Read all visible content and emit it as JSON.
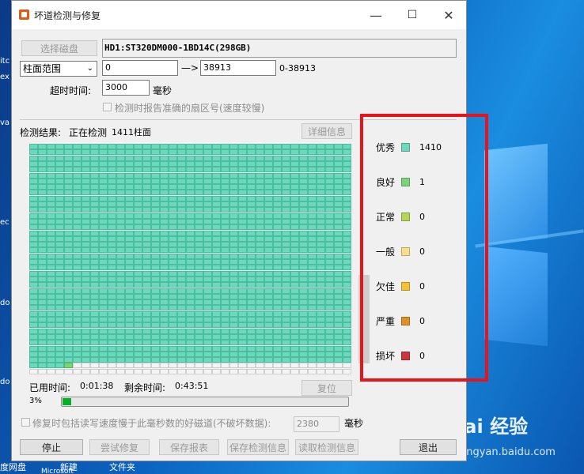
{
  "window": {
    "title": "坏道检测与修复",
    "minimize_icon": "—",
    "maximize_icon": "☐",
    "close_icon": "✕"
  },
  "disk": {
    "select_button": "选择磁盘",
    "name": "HD1:ST320DM000-1BD14C(298GB)"
  },
  "range": {
    "mode": "柱面范围",
    "from": "0",
    "arrow": "—>",
    "to": "38913",
    "hint": "0-38913"
  },
  "timeout": {
    "label": "超时时间:",
    "value": "3000",
    "unit": "毫秒"
  },
  "report_checkbox_label": "检测时报告准确的扇区号(速度较慢)",
  "result": {
    "label": "检测结果:",
    "status": "正在检测",
    "detail": "1411柱面",
    "detail_button": "详细信息"
  },
  "legend": [
    {
      "name": "优秀",
      "color": "#6fd8bc",
      "count": "1410"
    },
    {
      "name": "良好",
      "color": "#7dd37a",
      "count": "1"
    },
    {
      "name": "正常",
      "color": "#b5d45a",
      "count": "0"
    },
    {
      "name": "一般",
      "color": "#f7e08a",
      "count": "0"
    },
    {
      "name": "欠佳",
      "color": "#f5c233",
      "count": "0"
    },
    {
      "name": "严重",
      "color": "#e0902a",
      "count": "0"
    },
    {
      "name": "损坏",
      "color": "#c9373c",
      "count": "0"
    }
  ],
  "grid": {
    "total_cells": 1480,
    "filled_cells": 1410,
    "green_cells": 1,
    "columns": 37
  },
  "scroll": {
    "up": "˄",
    "down": "˅"
  },
  "time": {
    "elapsed_label": "已用时间:",
    "elapsed": "0:01:38",
    "remaining_label": "剩余时间:",
    "remaining": "0:43:51",
    "reset_button": "复位"
  },
  "progress": {
    "text": "3%",
    "fraction": 0.03
  },
  "repair_option": {
    "label": "修复时包括读写速度慢于此毫秒数的好磁道(不破坏数据):",
    "value": "2380",
    "unit": "毫秒"
  },
  "buttons": {
    "stop": "停止",
    "try_repair": "尝试修复",
    "save_report": "保存报表",
    "save_detect": "保存检测信息",
    "read_detect": "读取检测信息",
    "exit": "退出"
  },
  "desktop": {
    "watermark": "Bai  经验",
    "watermark_url": "jingyan.baidu.com",
    "left_labels": [
      "itc",
      "ex",
      "va",
      "ec",
      "do",
      "do"
    ],
    "taskbar": [
      "度网盘",
      "新建",
      "文件夹",
      "Microsoft"
    ]
  }
}
